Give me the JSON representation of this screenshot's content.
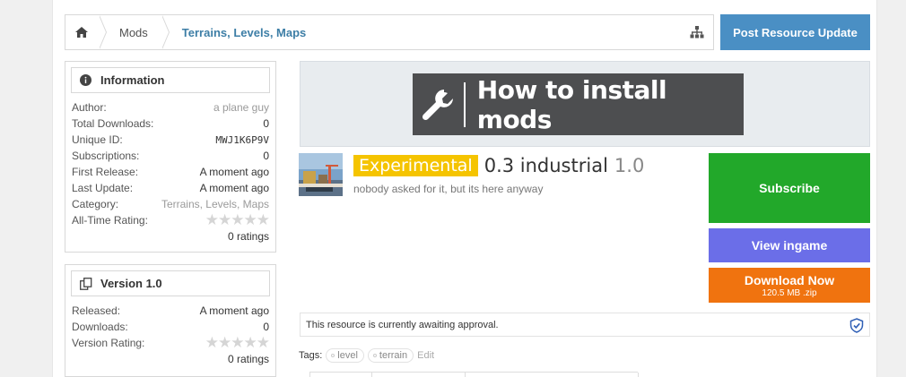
{
  "breadcrumb": {
    "home_icon": "home-icon",
    "items": [
      "Mods",
      "Terrains, Levels, Maps"
    ],
    "tree_icon": "sitemap-icon"
  },
  "header": {
    "post_update_label": "Post Resource Update"
  },
  "information": {
    "title": "Information",
    "rows": [
      {
        "label": "Author:",
        "value": "a plane guy"
      },
      {
        "label": "Total Downloads:",
        "value": "0"
      },
      {
        "label": "Unique ID:",
        "value": "MWJ1K6P9V"
      },
      {
        "label": "Subscriptions:",
        "value": "0"
      },
      {
        "label": "First Release:",
        "value": "A moment ago"
      },
      {
        "label": "Last Update:",
        "value": "A moment ago"
      },
      {
        "label": "Category:",
        "value": "Terrains, Levels, Maps"
      }
    ],
    "rating_label": "All-Time Rating:",
    "rating_stars": "★★★★★",
    "rating_count": "0 ratings"
  },
  "version": {
    "title": "Version 1.0",
    "rows": [
      {
        "label": "Released:",
        "value": "A moment ago"
      },
      {
        "label": "Downloads:",
        "value": "0"
      }
    ],
    "rating_label": "Version Rating:",
    "rating_stars": "★★★★★",
    "rating_count": "0 ratings"
  },
  "banner": {
    "text": "How to install mods"
  },
  "resource": {
    "prefix": "Experimental",
    "title": "0.3 industrial",
    "version": "1.0",
    "tagline": "nobody asked for it, but its here anyway"
  },
  "actions": {
    "subscribe": "Subscribe",
    "view_ingame": "View ingame",
    "download": "Download Now",
    "download_size": "120.5 MB .zip"
  },
  "notice": {
    "text": "This resource is currently awaiting approval."
  },
  "tags": {
    "label": "Tags:",
    "items": [
      "level",
      "terrain"
    ],
    "edit": "Edit"
  },
  "colors": {
    "accent_blue": "#4a8fc4",
    "subscribe_green": "#22a82a",
    "view_purple": "#6b6ee8",
    "download_orange": "#f0730f",
    "prefix_yellow": "#f5c400"
  }
}
